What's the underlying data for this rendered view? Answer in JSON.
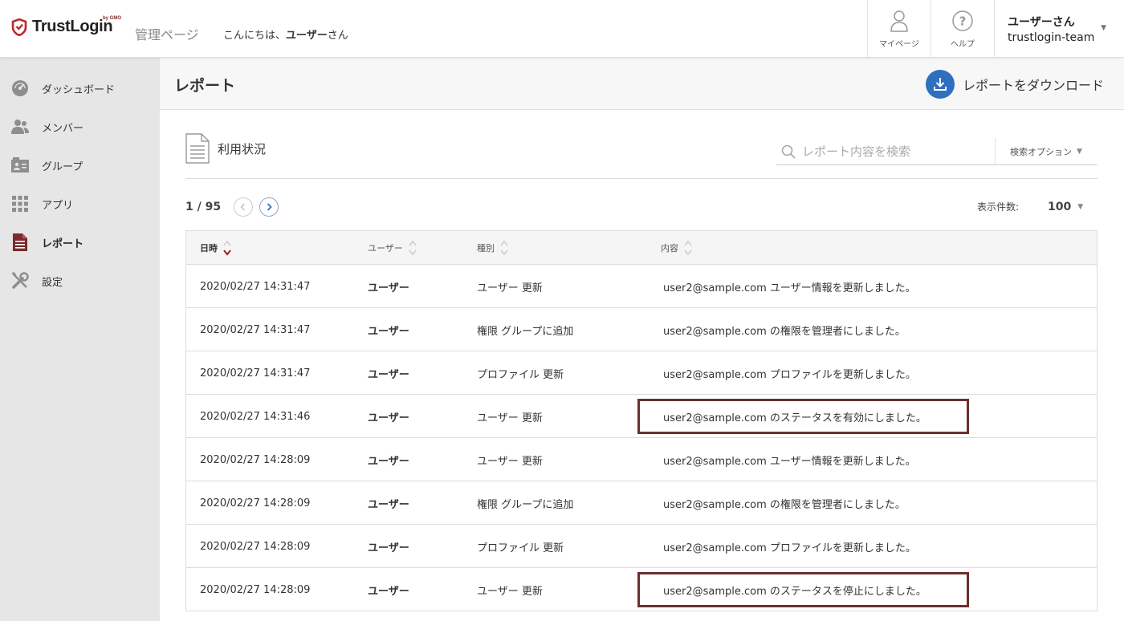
{
  "header": {
    "logo_text": "TrustLogin",
    "logo_sub": "by GMO",
    "admin_label": "管理ページ",
    "greeting_prefix": "こんにちは、",
    "greeting_name": "ユーザー",
    "greeting_suffix": "さん",
    "mypage_label": "マイページ",
    "help_label": "ヘルプ",
    "user_name": "ユーザーさん",
    "team_name": "trustlogin-team"
  },
  "sidebar": {
    "items": [
      {
        "label": "ダッシュボード",
        "icon": "dashboard-icon"
      },
      {
        "label": "メンバー",
        "icon": "members-icon"
      },
      {
        "label": "グループ",
        "icon": "group-icon"
      },
      {
        "label": "アプリ",
        "icon": "apps-grid-icon"
      },
      {
        "label": "レポート",
        "icon": "report-icon",
        "active": true
      },
      {
        "label": "設定",
        "icon": "settings-tools-icon"
      }
    ]
  },
  "main": {
    "title": "レポート",
    "download_label": "レポートをダウンロード",
    "section_label": "利用状況",
    "search_placeholder": "レポート内容を検索",
    "search_option_label": "検索オプション",
    "page_count": "1 / 95",
    "per_page_label": "表示件数:",
    "per_page_value": "100"
  },
  "table": {
    "columns": [
      "日時",
      "ユーザー",
      "種別",
      "内容"
    ],
    "rows": [
      {
        "datetime": "2020/02/27 14:31:47",
        "user": "ユーザー",
        "type": "ユーザー 更新",
        "content": "user2@sample.com ユーザー情報を更新しました。",
        "highlighted": false
      },
      {
        "datetime": "2020/02/27 14:31:47",
        "user": "ユーザー",
        "type": "権限 グループに追加",
        "content": "user2@sample.com の権限を管理者にしました。",
        "highlighted": false
      },
      {
        "datetime": "2020/02/27 14:31:47",
        "user": "ユーザー",
        "type": "プロファイル 更新",
        "content": "user2@sample.com プロファイルを更新しました。",
        "highlighted": false
      },
      {
        "datetime": "2020/02/27 14:31:46",
        "user": "ユーザー",
        "type": "ユーザー 更新",
        "content": "user2@sample.com のステータスを有効にしました。",
        "highlighted": true
      },
      {
        "datetime": "2020/02/27 14:28:09",
        "user": "ユーザー",
        "type": "ユーザー 更新",
        "content": "user2@sample.com ユーザー情報を更新しました。",
        "highlighted": false
      },
      {
        "datetime": "2020/02/27 14:28:09",
        "user": "ユーザー",
        "type": "権限 グループに追加",
        "content": "user2@sample.com の権限を管理者にしました。",
        "highlighted": false
      },
      {
        "datetime": "2020/02/27 14:28:09",
        "user": "ユーザー",
        "type": "プロファイル 更新",
        "content": "user2@sample.com プロファイルを更新しました。",
        "highlighted": false
      },
      {
        "datetime": "2020/02/27 14:28:09",
        "user": "ユーザー",
        "type": "ユーザー 更新",
        "content": "user2@sample.com のステータスを停止にしました。",
        "highlighted": true
      }
    ]
  },
  "colors": {
    "brand": "#c0262d",
    "accent_blue": "#2f6fc0",
    "highlight_border": "#6b2f2f",
    "sidebar_bg": "#e6e6e6"
  }
}
